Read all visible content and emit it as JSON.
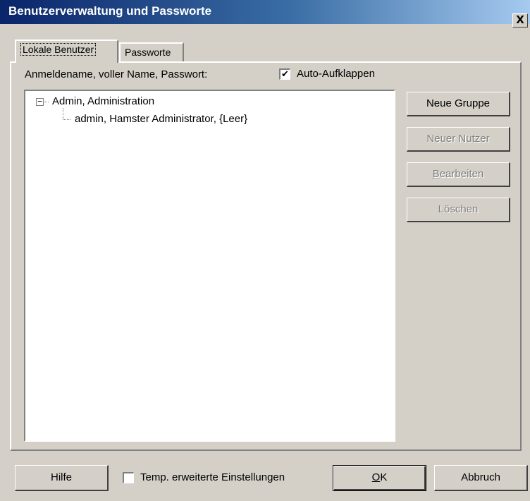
{
  "window": {
    "title": "Benutzerverwaltung und Passworte",
    "close_glyph": "X"
  },
  "tabs": [
    {
      "label": "Lokale Benutzer",
      "active": true
    },
    {
      "label": "Passworte",
      "active": false
    }
  ],
  "panel": {
    "column_label": "Anmeldename, voller Name, Passwort:",
    "auto_expand": {
      "label": "Auto-Aufklappen",
      "checked": true,
      "mark": "✔"
    }
  },
  "tree": {
    "expander": "−",
    "group": "Admin, Administration",
    "user": "admin, Hamster Administrator, {Leer}"
  },
  "side_buttons": {
    "new_group": "Neue Gruppe",
    "new_user": "Neuer Nutzer",
    "edit_first": "B",
    "edit_rest": "earbeiten",
    "delete": "Löschen"
  },
  "bottom": {
    "help": "Hilfe",
    "temp_settings": {
      "label": "Temp. erweiterte Einstellungen",
      "checked": false
    },
    "ok_first": "O",
    "ok_rest": "K",
    "cancel": "Abbruch"
  },
  "colors": {
    "face": "#d4d0c8",
    "title_start": "#0a246a",
    "title_end": "#a6caf0",
    "disabled_text": "#808080"
  }
}
